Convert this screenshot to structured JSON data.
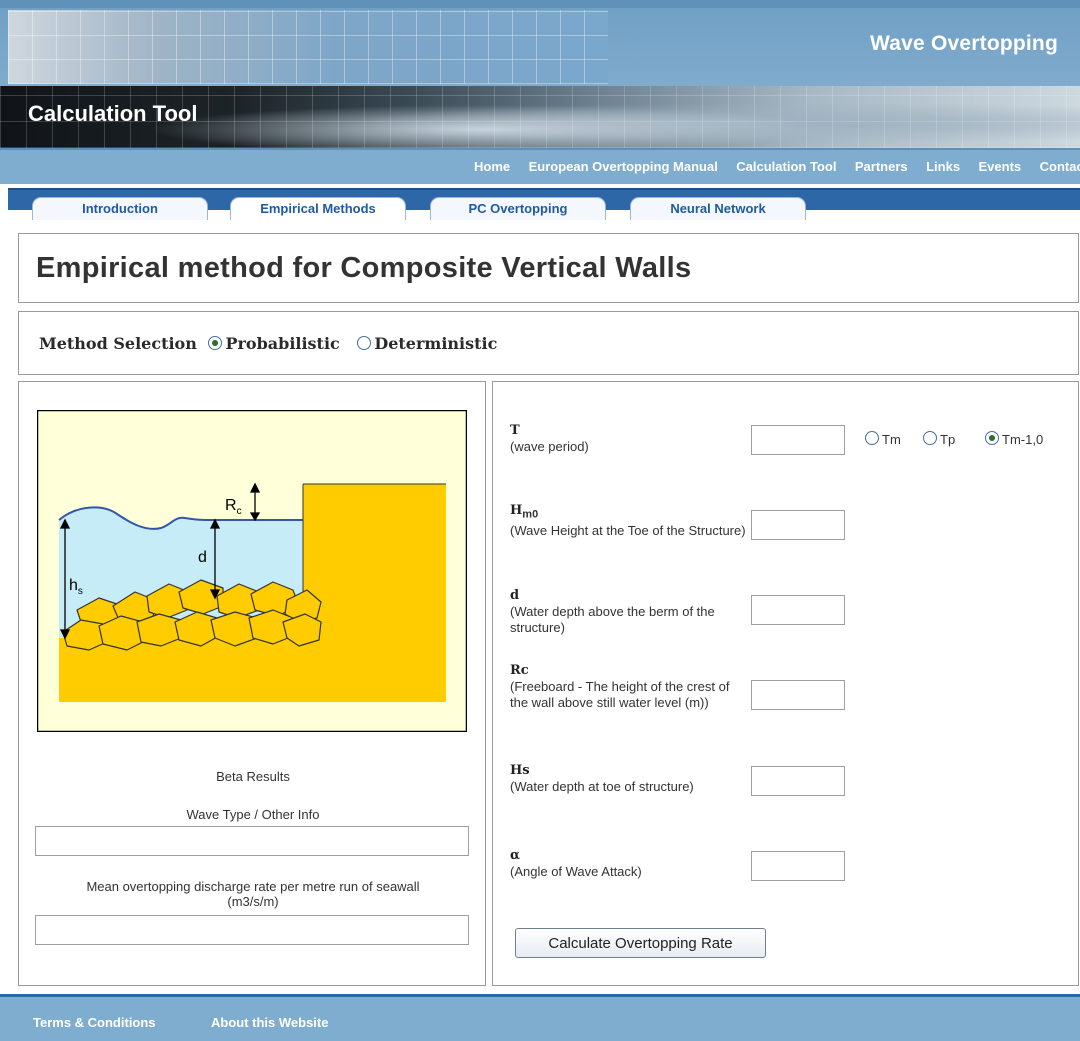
{
  "header": {
    "brand": "Wave Overtopping",
    "banner_title": "Calculation Tool"
  },
  "nav": {
    "items": [
      "Home",
      "European Overtopping Manual",
      "Calculation Tool",
      "Partners",
      "Links",
      "Events",
      "Contact"
    ]
  },
  "tabs": [
    {
      "label": "Introduction",
      "active": false
    },
    {
      "label": "Empirical Methods",
      "active": true
    },
    {
      "label": "PC Overtopping",
      "active": false
    },
    {
      "label": "Neural Network",
      "active": false
    }
  ],
  "page_title": "Empirical method for Composite Vertical Walls",
  "method": {
    "label": "Method Selection",
    "options": [
      "Probabilistic",
      "Deterministic"
    ],
    "selected": "Probabilistic"
  },
  "diagram": {
    "rc": "R",
    "rc_sub": "c",
    "d": "d",
    "hs": "h",
    "hs_sub": "s"
  },
  "results": {
    "beta_label": "Beta Results",
    "wave_type_label": "Wave Type / Other Info",
    "wave_type_value": "",
    "discharge_label": "Mean overtopping discharge rate per metre run of seawall",
    "discharge_unit": "(m3/s/m)",
    "discharge_value": ""
  },
  "fields": [
    {
      "symbol": "T",
      "desc": "(wave period)",
      "value": ""
    },
    {
      "symbol": "H",
      "symbol_sub": "m0",
      "desc": "(Wave Height at the Toe of the Structure)",
      "value": ""
    },
    {
      "symbol": "d",
      "desc": "(Water depth above the berm of the structure)",
      "value": ""
    },
    {
      "symbol": "Rc",
      "desc": "(Freeboard - The height of the crest of the wall above still water level (m))",
      "value": ""
    },
    {
      "symbol": "Hs",
      "desc": "(Water depth at toe of structure)",
      "value": ""
    },
    {
      "symbol": "α",
      "desc": "(Angle of Wave Attack)",
      "value": ""
    }
  ],
  "period_type": {
    "options": [
      "Tm",
      "Tp",
      "Tm-1,0"
    ],
    "selected": "Tm-1,0"
  },
  "calculate_button": "Calculate Overtopping Rate",
  "footer": {
    "links": [
      "Terms & Conditions",
      "About this Website"
    ]
  },
  "colors": {
    "nav_blue": "#7fadcf",
    "tab_band": "#2d67a8",
    "water": "#c6ecf7",
    "sand": "#ffcc00",
    "sky": "#ffffd9"
  }
}
